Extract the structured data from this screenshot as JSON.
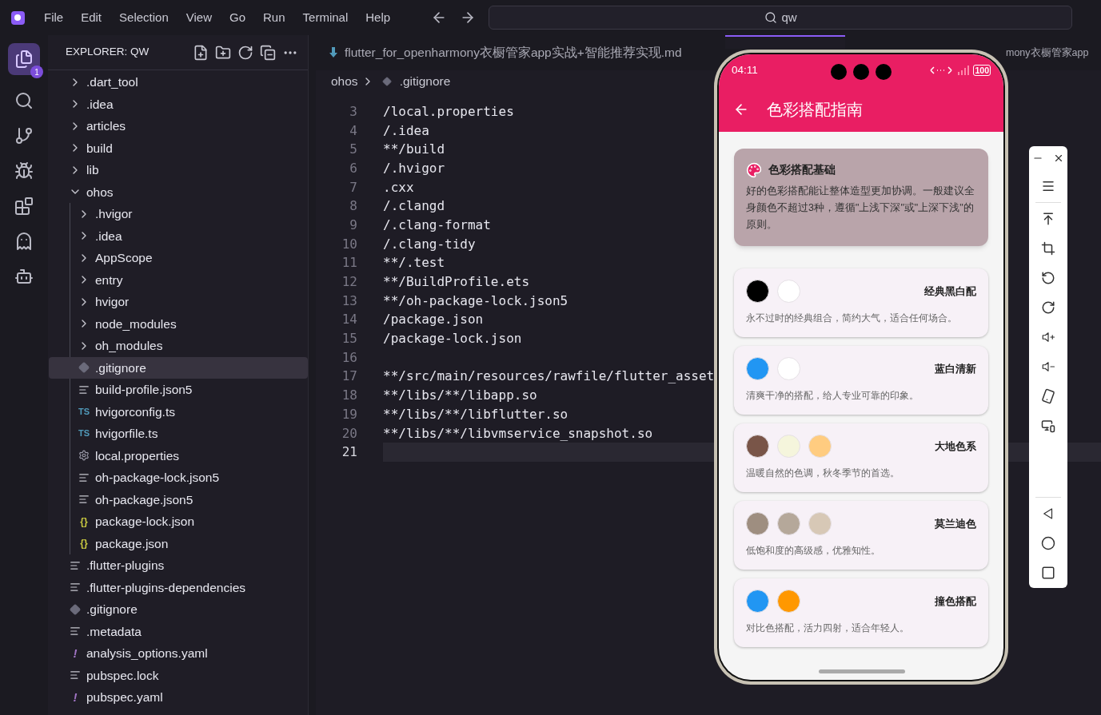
{
  "menu": [
    "File",
    "Edit",
    "Selection",
    "View",
    "Go",
    "Run",
    "Terminal",
    "Help"
  ],
  "search": {
    "value": "qw"
  },
  "activity_bar": {
    "badge": "1"
  },
  "explorer": {
    "title": "EXPLORER: QW",
    "tree": [
      {
        "kind": "folder",
        "label": ".dart_tool",
        "expanded": false,
        "selected": false
      },
      {
        "kind": "folder",
        "label": ".idea",
        "expanded": false,
        "selected": false
      },
      {
        "kind": "folder",
        "label": "articles",
        "expanded": false,
        "selected": false
      },
      {
        "kind": "folder",
        "label": "build",
        "expanded": false,
        "selected": false
      },
      {
        "kind": "folder",
        "label": "lib",
        "expanded": false,
        "selected": false
      },
      {
        "kind": "folder",
        "label": "ohos",
        "expanded": true,
        "selected": false,
        "children": [
          {
            "kind": "folder",
            "label": ".hvigor",
            "expanded": false,
            "selected": false
          },
          {
            "kind": "folder",
            "label": ".idea",
            "expanded": false,
            "selected": false
          },
          {
            "kind": "folder",
            "label": "AppScope",
            "expanded": false,
            "selected": false
          },
          {
            "kind": "folder",
            "label": "entry",
            "expanded": false,
            "selected": false
          },
          {
            "kind": "folder",
            "label": "hvigor",
            "expanded": false,
            "selected": false
          },
          {
            "kind": "folder",
            "label": "node_modules",
            "expanded": false,
            "selected": false
          },
          {
            "kind": "folder",
            "label": "oh_modules",
            "expanded": false,
            "selected": false
          },
          {
            "kind": "gitignore",
            "label": ".gitignore",
            "selected": true
          },
          {
            "kind": "text",
            "label": "build-profile.json5",
            "selected": false
          },
          {
            "kind": "ts",
            "label": "hvigorconfig.ts",
            "icon_text": "TS",
            "selected": false
          },
          {
            "kind": "ts",
            "label": "hvigorfile.ts",
            "icon_text": "TS",
            "selected": false
          },
          {
            "kind": "gear",
            "label": "local.properties",
            "selected": false
          },
          {
            "kind": "text",
            "label": "oh-package-lock.json5",
            "selected": false
          },
          {
            "kind": "text",
            "label": "oh-package.json5",
            "selected": false
          },
          {
            "kind": "json",
            "label": "package-lock.json",
            "icon_text": "{}",
            "selected": false
          },
          {
            "kind": "json",
            "label": "package.json",
            "icon_text": "{}",
            "selected": false
          }
        ]
      },
      {
        "kind": "text",
        "label": ".flutter-plugins",
        "selected": false
      },
      {
        "kind": "text",
        "label": ".flutter-plugins-dependencies",
        "selected": false
      },
      {
        "kind": "gitignore",
        "label": ".gitignore",
        "selected": false
      },
      {
        "kind": "text",
        "label": ".metadata",
        "selected": false
      },
      {
        "kind": "yaml",
        "label": "analysis_options.yaml",
        "icon_text": "!",
        "selected": false
      },
      {
        "kind": "text",
        "label": "pubspec.lock",
        "selected": false
      },
      {
        "kind": "yaml",
        "label": "pubspec.yaml",
        "icon_text": "!",
        "selected": false
      }
    ]
  },
  "tabs": [
    {
      "label": "flutter_for_openharmony衣橱管家app实战+智能推荐实现.md",
      "selected": false
    },
    {
      "selected": true
    },
    {
      "label": "mony衣橱管家app",
      "selected": false
    }
  ],
  "breadcrumbs": [
    "ohos",
    ".gitignore"
  ],
  "code": [
    {
      "num": "3",
      "text": "/local.properties",
      "current": false
    },
    {
      "num": "4",
      "text": "/.idea",
      "current": false
    },
    {
      "num": "5",
      "text": "**/build",
      "current": false
    },
    {
      "num": "6",
      "text": "/.hvigor",
      "current": false
    },
    {
      "num": "7",
      "text": ".cxx",
      "current": false
    },
    {
      "num": "8",
      "text": "/.clangd",
      "current": false
    },
    {
      "num": "9",
      "text": "/.clang-format",
      "current": false
    },
    {
      "num": "10",
      "text": "/.clang-tidy",
      "current": false
    },
    {
      "num": "11",
      "text": "**/.test",
      "current": false
    },
    {
      "num": "12",
      "text": "**/BuildProfile.ets",
      "current": false
    },
    {
      "num": "13",
      "text": "**/oh-package-lock.json5",
      "current": false
    },
    {
      "num": "14",
      "text": "/package.json",
      "current": false
    },
    {
      "num": "15",
      "text": "/package-lock.json",
      "current": false
    },
    {
      "num": "16",
      "current": false
    },
    {
      "num": "17",
      "text": "**/src/main/resources/rawfile/flutter_asset",
      "current": false
    },
    {
      "num": "18",
      "text": "**/libs/**/libapp.so",
      "current": false
    },
    {
      "num": "19",
      "text": "**/libs/**/libflutter.so",
      "current": false
    },
    {
      "num": "20",
      "text": "**/libs/**/libvmservice_snapshot.so",
      "current": false
    },
    {
      "num": "21",
      "current": true
    }
  ],
  "phone": {
    "time": "04:11",
    "battery": "100",
    "title": "色彩搭配指南",
    "info": {
      "title": "色彩搭配基础",
      "body": "好的色彩搭配能让整体造型更加协调。一般建议全身颜色不超过3种，遵循\"上浅下深\"或\"上深下浅\"的原则。"
    },
    "palettes": [
      {
        "name": "经典黑白配",
        "description": "永不过时的经典组合，简约大气，适合任何场合。",
        "colors": [
          {
            "color": "#000000"
          },
          {
            "color": "#ffffff"
          }
        ]
      },
      {
        "name": "蓝白清新",
        "description": "清爽干净的搭配，给人专业可靠的印象。",
        "colors": [
          {
            "color": "#2196f3"
          },
          {
            "color": "#ffffff"
          }
        ]
      },
      {
        "name": "大地色系",
        "description": "温暖自然的色调，秋冬季节的首选。",
        "colors": [
          {
            "color": "#795548"
          },
          {
            "color": "#f5f5dc"
          },
          {
            "color": "#ffcc80"
          }
        ]
      },
      {
        "name": "莫兰迪色",
        "description": "低饱和度的高级感，优雅知性。",
        "colors": [
          {
            "color": "#9e8e80"
          },
          {
            "color": "#b5a89a"
          },
          {
            "color": "#d7c8b6"
          }
        ]
      },
      {
        "name": "撞色搭配",
        "description": "对比色搭配，活力四射，适合年轻人。",
        "colors": [
          {
            "color": "#2196f3"
          },
          {
            "color": "#ff9800"
          }
        ]
      }
    ]
  }
}
